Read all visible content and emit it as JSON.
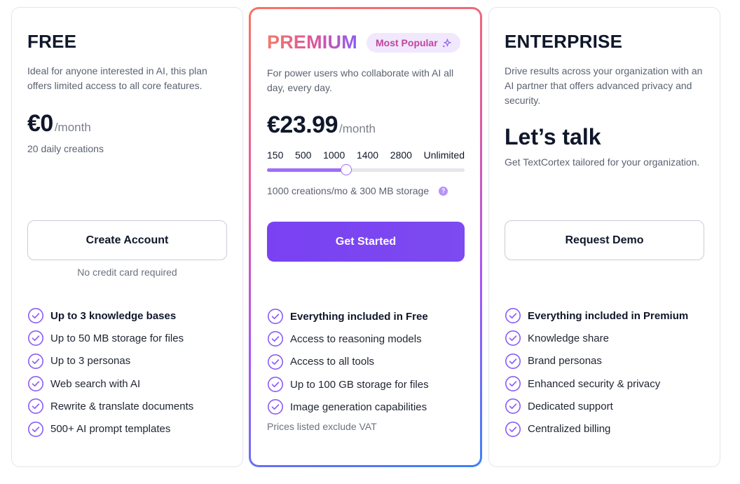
{
  "free": {
    "title": "FREE",
    "description": "Ideal for anyone interested in AI, this plan offers limited access to all core features.",
    "price": "€0",
    "period": "/month",
    "sub": "20 daily creations",
    "button": "Create Account",
    "note": "No credit card required",
    "features": [
      {
        "text": "Up to 3 knowledge bases",
        "bold": true
      },
      {
        "text": "Up to 50 MB storage for files",
        "bold": false
      },
      {
        "text": "Up to 3 personas",
        "bold": false
      },
      {
        "text": "Web search with AI",
        "bold": false
      },
      {
        "text": "Rewrite & translate documents",
        "bold": false
      },
      {
        "text": "500+ AI prompt templates",
        "bold": false
      }
    ]
  },
  "premium": {
    "title": "PREMIUM",
    "badge": "Most Popular",
    "badge_icon": "sparkle-icon",
    "description": "For power users who collaborate with AI all day, every day.",
    "price": "€23.99",
    "period": "/month",
    "slider": {
      "options": [
        "150",
        "500",
        "1000",
        "1400",
        "2800",
        "Unlimited"
      ],
      "selected": "1000",
      "selected_fraction": 0.4
    },
    "storage": "1000 creations/mo & 300 MB storage",
    "help_icon": "?",
    "button": "Get Started",
    "features": [
      {
        "text": "Everything included in Free",
        "bold": true
      },
      {
        "text": "Access to reasoning models",
        "bold": false
      },
      {
        "text": "Access to all tools",
        "bold": false
      },
      {
        "text": "Up to 100 GB storage for files",
        "bold": false
      },
      {
        "text": "Image generation capabilities",
        "bold": false
      }
    ],
    "vat_note": "Prices listed exclude VAT"
  },
  "enterprise": {
    "title": "ENTERPRISE",
    "description": "Drive results across your organization with an AI partner that offers advanced privacy and security.",
    "headline": "Let’s talk",
    "sub": "Get TextCortex tailored for your organization.",
    "button": "Request Demo",
    "features": [
      {
        "text": "Everything included in Premium",
        "bold": true
      },
      {
        "text": "Knowledge share",
        "bold": false
      },
      {
        "text": "Brand personas",
        "bold": false
      },
      {
        "text": "Enhanced security & privacy",
        "bold": false
      },
      {
        "text": "Dedicated support",
        "bold": false
      },
      {
        "text": "Centralized billing",
        "bold": false
      }
    ]
  },
  "colors": {
    "accent": "#7c3aed",
    "check": "#8b5cf6",
    "badge_bg": "#f1e8fd"
  }
}
